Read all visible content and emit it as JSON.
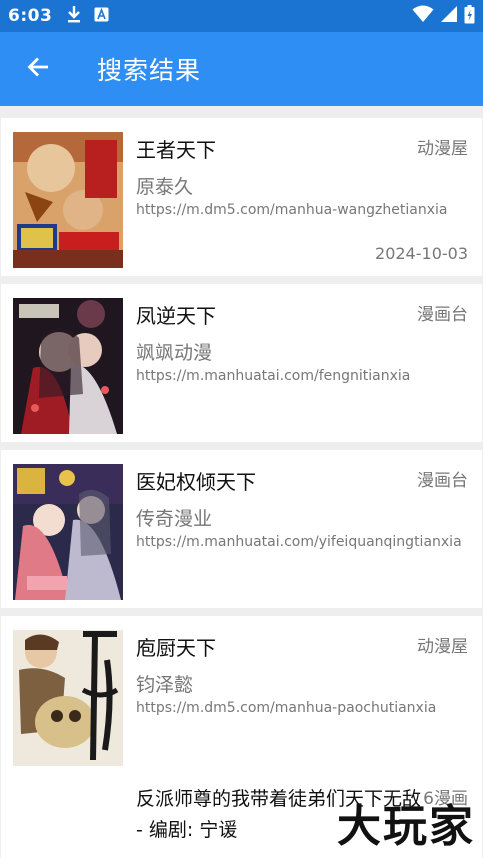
{
  "status": {
    "time": "6:03"
  },
  "appbar": {
    "title": "搜索结果"
  },
  "results": [
    {
      "title": "王者天下",
      "source": "动漫屋",
      "author": "原泰久",
      "url": "https://m.dm5.com/manhua-wangzhetianxia",
      "date": "2024-10-03"
    },
    {
      "title": "凤逆天下",
      "source": "漫画台",
      "author": "飒飒动漫",
      "url": "https://m.manhuatai.com/fengnitianxia",
      "date": ""
    },
    {
      "title": "医妃权倾天下",
      "source": "漫画台",
      "author": "传奇漫业",
      "url": "https://m.manhuatai.com/yifeiquanqingtianxia",
      "date": ""
    },
    {
      "title": "庖厨天下",
      "source": "动漫屋",
      "author": "钧泽懿",
      "url": "https://m.dm5.com/manhua-paochutianxia",
      "date": ""
    }
  ],
  "last_result": {
    "title": "反派师尊的我带着徒弟们天下无敌 - 编剧: 宁谖",
    "source": "6漫画"
  },
  "watermark": "大玩家",
  "colors": {
    "status_bar": "#1b74d2",
    "app_bar": "#2f8ef4",
    "background": "#eeeeee"
  }
}
